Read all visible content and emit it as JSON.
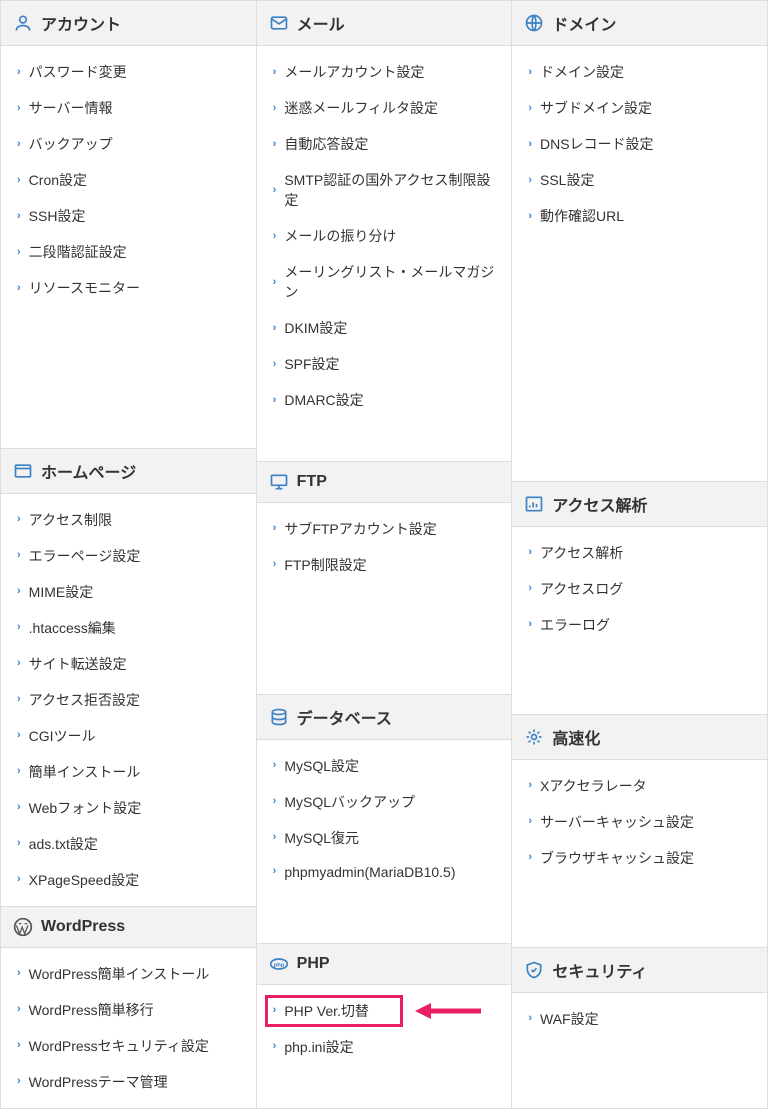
{
  "columns": [
    [
      {
        "id": "account",
        "icon": "user",
        "iconColor": "blue",
        "title": "アカウント",
        "items": [
          {
            "label": "パスワード変更"
          },
          {
            "label": "サーバー情報"
          },
          {
            "label": "バックアップ"
          },
          {
            "label": "Cron設定"
          },
          {
            "label": "SSH設定"
          },
          {
            "label": "二段階認証設定"
          },
          {
            "label": "リソースモニター"
          }
        ]
      },
      {
        "id": "homepage",
        "icon": "window",
        "iconColor": "blue",
        "title": "ホームページ",
        "items": [
          {
            "label": "アクセス制限"
          },
          {
            "label": "エラーページ設定"
          },
          {
            "label": "MIME設定"
          },
          {
            "label": ".htaccess編集"
          },
          {
            "label": "サイト転送設定"
          },
          {
            "label": "アクセス拒否設定"
          },
          {
            "label": "CGIツール"
          },
          {
            "label": "簡単インストール"
          },
          {
            "label": "Webフォント設定"
          },
          {
            "label": "ads.txt設定"
          },
          {
            "label": "XPageSpeed設定"
          }
        ]
      },
      {
        "id": "wordpress",
        "icon": "wordpress",
        "iconColor": "dark",
        "title": "WordPress",
        "items": [
          {
            "label": "WordPress簡単インストール"
          },
          {
            "label": "WordPress簡単移行"
          },
          {
            "label": "WordPressセキュリティ設定"
          },
          {
            "label": "WordPressテーマ管理"
          }
        ]
      }
    ],
    [
      {
        "id": "mail",
        "icon": "mail",
        "iconColor": "blue",
        "title": "メール",
        "items": [
          {
            "label": "メールアカウント設定"
          },
          {
            "label": "迷惑メールフィルタ設定"
          },
          {
            "label": "自動応答設定"
          },
          {
            "label": "SMTP認証の国外アクセス制限設定"
          },
          {
            "label": "メールの振り分け"
          },
          {
            "label": "メーリングリスト・メールマガジン"
          },
          {
            "label": "DKIM設定"
          },
          {
            "label": "SPF設定"
          },
          {
            "label": "DMARC設定"
          }
        ]
      },
      {
        "id": "ftp",
        "icon": "monitor",
        "iconColor": "blue",
        "title": "FTP",
        "items": [
          {
            "label": "サブFTPアカウント設定"
          },
          {
            "label": "FTP制限設定"
          }
        ]
      },
      {
        "id": "database",
        "icon": "database",
        "iconColor": "blue",
        "title": "データベース",
        "items": [
          {
            "label": "MySQL設定"
          },
          {
            "label": "MySQLバックアップ"
          },
          {
            "label": "MySQL復元"
          },
          {
            "label": "phpmyadmin(MariaDB10.5)"
          }
        ]
      },
      {
        "id": "php",
        "icon": "php",
        "iconColor": "blue",
        "title": "PHP",
        "items": [
          {
            "label": "PHP Ver.切替",
            "highlighted": true
          },
          {
            "label": "php.ini設定"
          }
        ]
      }
    ],
    [
      {
        "id": "domain",
        "icon": "globe",
        "iconColor": "blue",
        "title": "ドメイン",
        "items": [
          {
            "label": "ドメイン設定"
          },
          {
            "label": "サブドメイン設定"
          },
          {
            "label": "DNSレコード設定"
          },
          {
            "label": "SSL設定"
          },
          {
            "label": "動作確認URL"
          }
        ]
      },
      {
        "id": "analytics",
        "icon": "chart",
        "iconColor": "blue",
        "title": "アクセス解析",
        "items": [
          {
            "label": "アクセス解析"
          },
          {
            "label": "アクセスログ"
          },
          {
            "label": "エラーログ"
          }
        ]
      },
      {
        "id": "speed",
        "icon": "speed",
        "iconColor": "blue",
        "title": "高速化",
        "items": [
          {
            "label": "Xアクセラレータ"
          },
          {
            "label": "サーバーキャッシュ設定"
          },
          {
            "label": "ブラウザキャッシュ設定"
          }
        ]
      },
      {
        "id": "security",
        "icon": "shield",
        "iconColor": "blue",
        "title": "セキュリティ",
        "items": [
          {
            "label": "WAF設定"
          }
        ]
      }
    ]
  ],
  "highlight_color": "#e91e63",
  "accent_color": "#3b82c4"
}
